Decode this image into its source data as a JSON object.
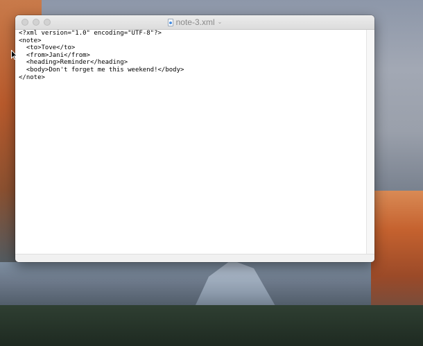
{
  "window": {
    "title": "note-3.xml",
    "title_chevron": "⌄",
    "document_icon": "xml-document-icon"
  },
  "editor": {
    "lines": [
      "<?xml version=\"1.0\" encoding=\"UTF-8\"?>",
      "<note>",
      "  <to>Tove</to>",
      "  <from>Jani</from>",
      "  <heading>Reminder</heading>",
      "  <body>Don't forget me this weekend!</body>",
      "</note>"
    ]
  },
  "colors": {
    "traffic_light_inactive": "#d2d2d2",
    "title_text": "#8a8a8a",
    "editor_background": "#ffffff"
  }
}
